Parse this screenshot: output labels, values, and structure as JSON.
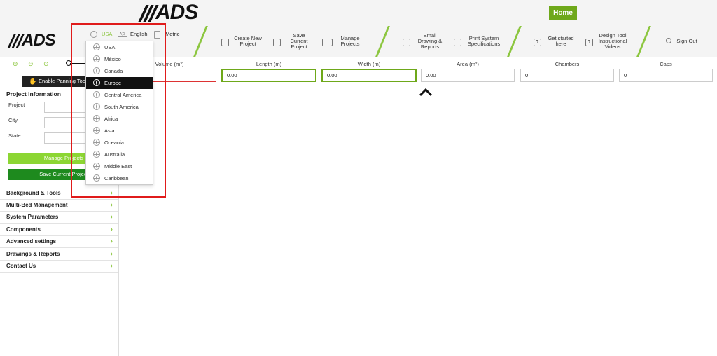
{
  "brand": {
    "logo": "ADS"
  },
  "header": {
    "home_label": "Home"
  },
  "locale": {
    "region": "USA",
    "language": "English",
    "units": "Metric"
  },
  "toolbar": [
    {
      "name": "create-new-project-button",
      "label": "Create New\nProject"
    },
    {
      "name": "save-current-project-button",
      "label": "Save\nCurrent\nProject"
    },
    {
      "name": "manage-projects-button",
      "label": "Manage\nProjects"
    },
    {
      "name": "email-drawing-reports-button",
      "label": "Email\nDrawing &\nReports"
    },
    {
      "name": "print-system-specifications-button",
      "label": "Print System\nSpecifications"
    },
    {
      "name": "get-started-here-button",
      "label": "Get started\nhere"
    },
    {
      "name": "design-tool-videos-button",
      "label": "Design Tool\nInstructional\nVideos"
    },
    {
      "name": "sign-out-button",
      "label": "Sign Out"
    }
  ],
  "fields": [
    {
      "label": "Volume (m³)",
      "value": ""
    },
    {
      "label": "Length (m)",
      "value": "0.00"
    },
    {
      "label": "Width (m)",
      "value": "0.00"
    },
    {
      "label": "Area (m²)",
      "value": "0.00"
    },
    {
      "label": "Chambers",
      "value": "0"
    },
    {
      "label": "Caps",
      "value": "0"
    }
  ],
  "left_panel": {
    "pan_button": "Enable Panning Tool",
    "project_info_title": "Project Information",
    "project_label": "Project",
    "city_label": "City",
    "state_label": "State",
    "manage_projects": "Manage Projects",
    "save_current_project": "Save Current Project",
    "sections": [
      "Background & Tools",
      "Multi-Bed Management",
      "System Parameters",
      "Components",
      "Advanced settings",
      "Drawings & Reports",
      "Contact Us"
    ]
  },
  "region_dropdown": {
    "selected": "Europe",
    "options": [
      "USA",
      "México",
      "Canada",
      "Europe",
      "Central America",
      "South America",
      "Africa",
      "Asia",
      "Oceania",
      "Australia",
      "Middle East",
      "Caribbean"
    ]
  },
  "colors": {
    "accent": "#8cc63f",
    "home": "#6ea81a",
    "highlight": "#e01b1b"
  }
}
